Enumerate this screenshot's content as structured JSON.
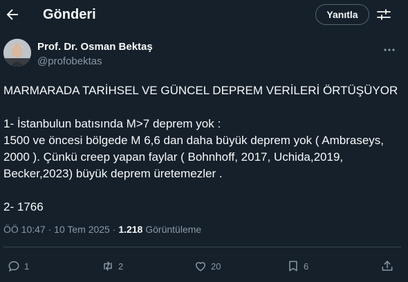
{
  "header": {
    "title": "Gönderi",
    "reply_label": "Yanıtla"
  },
  "author": {
    "name": "Prof. Dr. Osman Bektaş",
    "handle": "@profobektas"
  },
  "post": {
    "text": "MARMARADA TARİHSEL VE GÜNCEL DEPREM VERİLERİ ÖRTÜŞÜYOR\n\n1- İstanbulun batısında M>7 deprem yok :\n1500 ve öncesi bölgede M 6,6 dan daha büyük deprem yok ( Ambraseys, 2000 ). Çünkü creep yapan faylar ( Bohnhoff, 2017, Uchida,2019, Becker,2023) büyük deprem üretemezler .\n\n2- 1766",
    "time": "ÖÖ 10:47",
    "date": "10 Tem 2025",
    "separator": "·",
    "views": "1.218",
    "views_label": "Görüntüleme"
  },
  "actions": {
    "replies": "1",
    "reposts": "2",
    "likes": "20",
    "bookmarks": "6"
  },
  "icons": {
    "back": "arrow-left-icon",
    "settings": "sliders-icon",
    "more": "more-horizontal-icon",
    "reply": "speech-bubble-icon",
    "repost": "repost-icon",
    "like": "heart-icon",
    "bookmark": "bookmark-icon",
    "share": "share-icon"
  },
  "colors": {
    "background": "#15202b",
    "text": "#f7f9f9",
    "secondary": "#8b98a5",
    "divider": "#38444d"
  }
}
